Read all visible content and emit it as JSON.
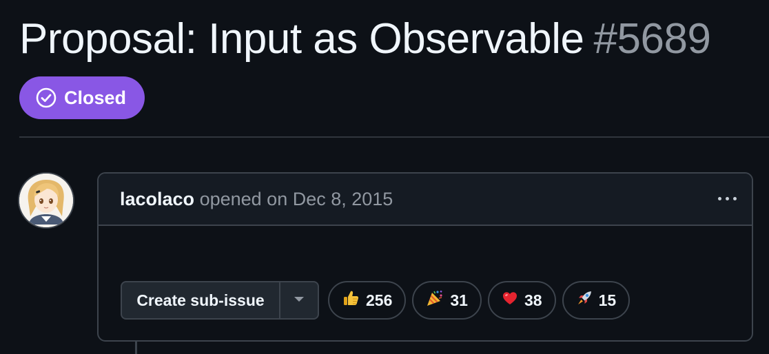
{
  "issue": {
    "title": "Proposal: Input as Observable",
    "number": "#5689",
    "state": "Closed",
    "state_color": "#8957e5"
  },
  "comment": {
    "author": "lacolaco",
    "action": "opened on Dec 8, 2015"
  },
  "actions": {
    "create_sub_issue": "Create sub-issue"
  },
  "reactions": [
    {
      "icon": "thumbs-up-icon",
      "count": "256"
    },
    {
      "icon": "tada-icon",
      "count": "31"
    },
    {
      "icon": "heart-icon",
      "count": "38"
    },
    {
      "icon": "rocket-icon",
      "count": "15"
    }
  ],
  "colors": {
    "background": "#0d1117",
    "border": "#3d444d",
    "muted_text": "#9198a1"
  }
}
